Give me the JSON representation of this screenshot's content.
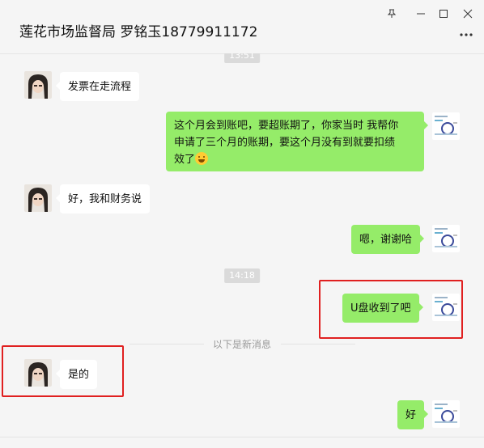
{
  "window": {
    "title": "莲花市场监督局 罗铭玉18779911172",
    "pin_icon": "pin-icon",
    "minimize_icon": "minimize-icon",
    "maximize_icon": "maximize-icon",
    "close_icon": "close-icon",
    "more_icon": "more-icon"
  },
  "colors": {
    "sent_bubble": "#95ec69",
    "received_bubble": "#ffffff",
    "highlight": "#e02020",
    "background": "#f5f5f5"
  },
  "messages": [
    {
      "time": "13:51"
    },
    {
      "from": "other",
      "text": "发票在走流程"
    },
    {
      "from": "me",
      "line1": "这个月会到账吧，要超账期了，你家当时 我帮你",
      "line2": "申请了三个月的账期，要这个月没有到就要扣绩",
      "line3": "效了"
    },
    {
      "from": "other",
      "text": "好，我和财务说"
    },
    {
      "from": "me",
      "text": "嗯，谢谢哈"
    },
    {
      "time": "14:18"
    },
    {
      "from": "me",
      "text": "U盘收到了吧"
    },
    {
      "divider": "以下是新消息"
    },
    {
      "from": "other",
      "text": "是的"
    },
    {
      "from": "me",
      "text": "好"
    }
  ]
}
